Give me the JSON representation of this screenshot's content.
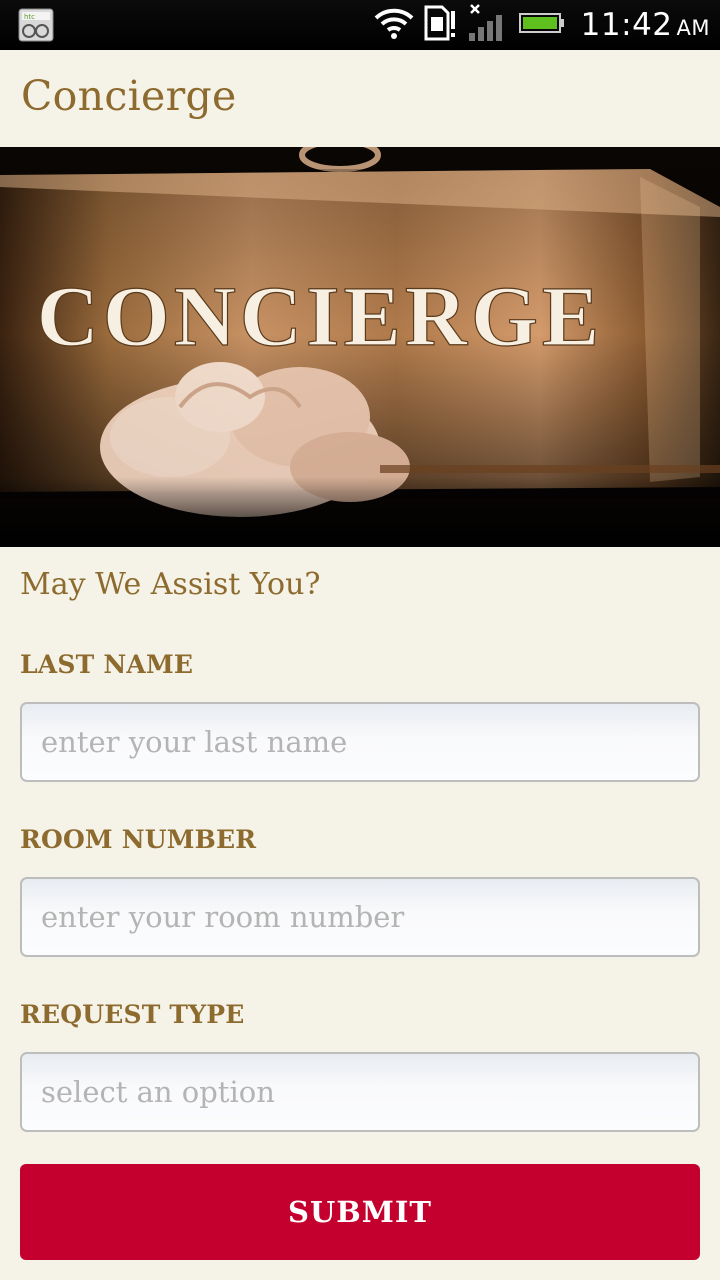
{
  "status_bar": {
    "left_icon": "htc-sync-icon",
    "icons": [
      "wifi-icon",
      "sim-alert-icon",
      "signal-no-service-icon",
      "battery-charging-icon"
    ],
    "time": "11:42",
    "ampm": "AM"
  },
  "header": {
    "title": "Concierge"
  },
  "hero": {
    "sign_text": "CONCIERGE"
  },
  "form": {
    "heading": "May We Assist You?",
    "last_name": {
      "label": "LAST NAME",
      "placeholder": "enter your last name",
      "value": ""
    },
    "room_number": {
      "label": "ROOM NUMBER",
      "placeholder": "enter your room number",
      "value": ""
    },
    "request_type": {
      "label": "REQUEST TYPE",
      "placeholder": "select an option"
    },
    "submit_label": "SUBMIT"
  },
  "colors": {
    "background": "#f5f2e7",
    "accent_gold": "#8d6a2e",
    "submit_red": "#c4002f"
  }
}
